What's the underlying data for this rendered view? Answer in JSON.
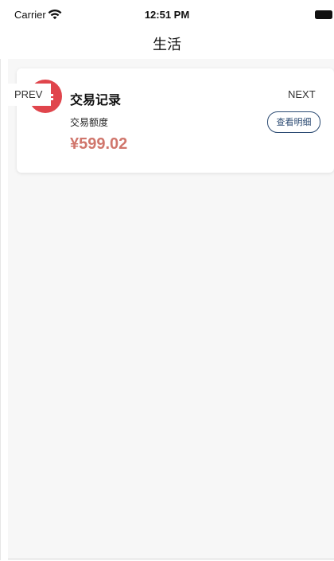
{
  "status_bar": {
    "carrier": "Carrier",
    "time": "12:51 PM"
  },
  "nav": {
    "title": "生活"
  },
  "card": {
    "prev_label": "PREV",
    "next_label": "NEXT",
    "title": "交易记录",
    "amount_label": "交易额度",
    "amount_value": "¥599.02",
    "detail_button": "查看明细",
    "icon": "record-icon"
  },
  "colors": {
    "accent_red": "#e0454c",
    "amount": "#d0766c",
    "detail_border": "#2b4a72",
    "background": "#f7f7f7"
  }
}
